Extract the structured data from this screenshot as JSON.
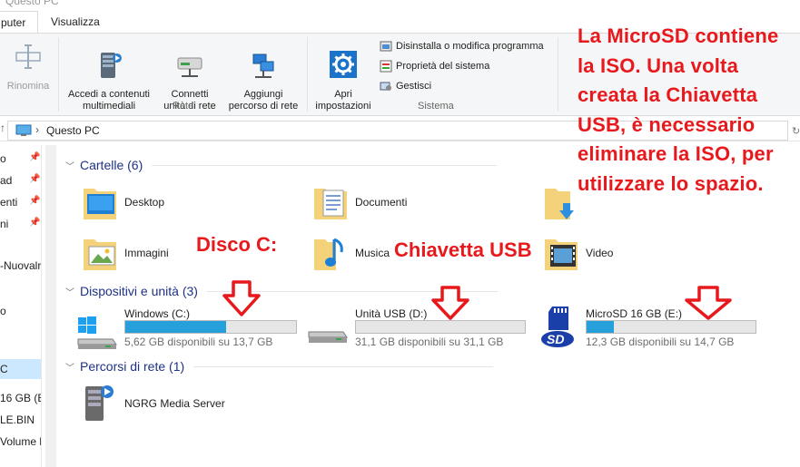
{
  "window": {
    "title": "Questo PC"
  },
  "tabs": {
    "home": "puter",
    "view": "Visualizza"
  },
  "ribbon": {
    "rename": "Rinomina",
    "media": "Accedi a contenuti\nmultimediali",
    "map_drive": "Connetti\nunità di rete",
    "add_location": "Aggiungi\npercorso di rete",
    "open_settings": "Apri\nimpostazioni",
    "uninstall": "Disinstalla o modifica programma",
    "system_props": "Proprietà del sistema",
    "manage": "Gestisci",
    "group_network": "Rete",
    "group_system": "Sistema"
  },
  "address": {
    "location": "Questo PC"
  },
  "nav": {
    "items": [
      "o",
      "ad",
      "enti",
      "ni",
      "-Nuovalr",
      "o",
      "C",
      "16 GB (E:",
      "LE.BIN",
      "Volume l"
    ]
  },
  "sections": {
    "folders": "Cartelle (6)",
    "devices": "Dispositivi e unità (3)",
    "network": "Percorsi di rete (1)"
  },
  "folders": [
    {
      "name": "Desktop"
    },
    {
      "name": "Documenti"
    },
    {
      "name": ""
    },
    {
      "name": "Immagini"
    },
    {
      "name": "Musica"
    },
    {
      "name": "Video"
    }
  ],
  "drives": [
    {
      "name": "Windows (C:)",
      "free": "5,62 GB disponibili su 13,7 GB",
      "used_fraction": 0.59
    },
    {
      "name": "Unità USB (D:)",
      "free": "31,1 GB disponibili su 31,1 GB",
      "used_fraction": 0.0
    },
    {
      "name": "MicroSD 16 GB (E:)",
      "free": "12,3 GB disponibili su 14,7 GB",
      "used_fraction": 0.16
    }
  ],
  "network_locations": [
    {
      "name": "NGRG Media Server"
    }
  ],
  "annotations": {
    "note": "La MicroSD contiene\nla ISO. Una volta\ncreata la Chiavetta\nUSB, è necessario\neliminare la ISO, per\nutilizzare lo spazio.",
    "disk_c": "Disco C:",
    "usb": "Chiavetta USB"
  },
  "colors": {
    "accent": "#26a0da",
    "annotation": "#e8191c",
    "section_header": "#1e3287"
  }
}
